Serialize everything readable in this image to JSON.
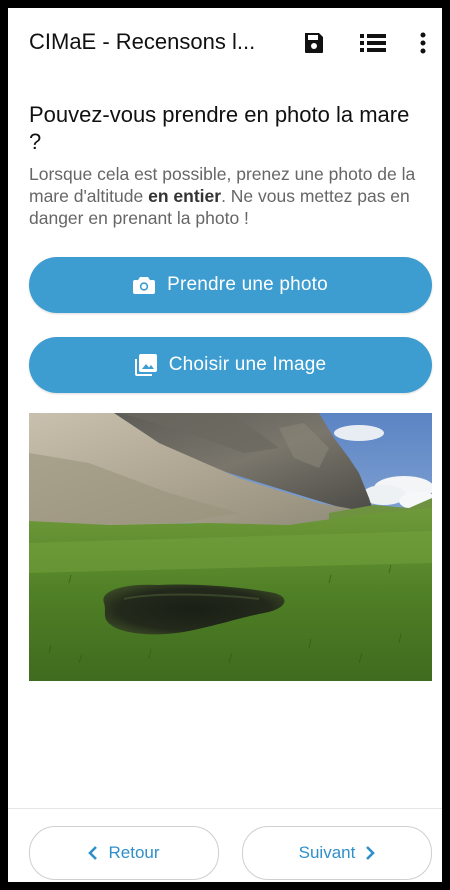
{
  "appbar": {
    "title": "CIMaE - Recensons l...",
    "icons": [
      "save-icon",
      "list-icon",
      "more-vert-icon"
    ]
  },
  "question": {
    "title": "Pouvez-vous prendre en photo la mare ?",
    "hint_part1": "Lorsque cela est possible, prenez une photo de la mare d'altitude ",
    "hint_bold": "en entier",
    "hint_part2": ". Ne vous mettez pas en danger en prenant la photo !"
  },
  "buttons": {
    "take_photo": "Prendre une photo",
    "choose_image": "Choisir une Image"
  },
  "nav": {
    "back": "Retour",
    "next": "Suivant"
  },
  "colors": {
    "primary": "#3d9dd1",
    "nav_text": "#2f8fc9"
  }
}
